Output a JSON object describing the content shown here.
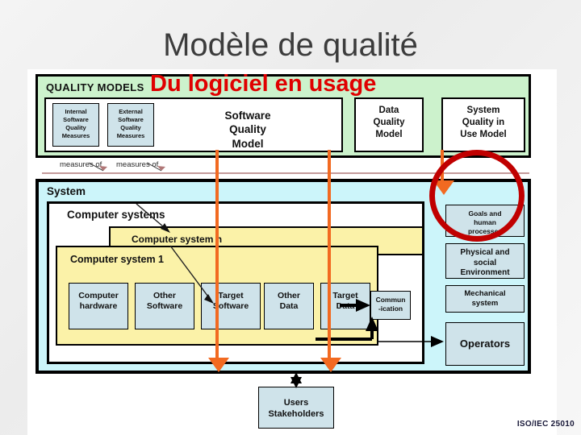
{
  "slide": {
    "title": "Modèle de qualité",
    "subtitle": "Du logiciel en usage",
    "footer": "ISO/IEC 25010"
  },
  "quality_models": {
    "panel_title": "QUALITY MODELS",
    "measure_boxes": [
      {
        "label": "Internal\nSoftware\nQuality\nMeasures"
      },
      {
        "label": "External\nSoftware\nQuality\nMeasures"
      }
    ],
    "software_quality_model": "Software\nQuality\nModel",
    "data_quality_model": "Data\nQuality\nModel",
    "system_quality_in_use_model": "System\nQuality in\nUse Model"
  },
  "measures_band": {
    "left_label": "measures of",
    "right_label": "measures of"
  },
  "system": {
    "panel_title": "System",
    "computer_systems_title": "Computer systems",
    "computer_system_n": "Computer system n",
    "computer_system_1": "Computer system 1",
    "leaves": [
      {
        "label": "Computer\nhardware"
      },
      {
        "label": "Other\nSoftware"
      },
      {
        "label": "Target\nSoftware"
      },
      {
        "label": "Other\nData"
      },
      {
        "label": "Target\nData"
      }
    ],
    "communication": "Commun\n-ication",
    "context_boxes": [
      {
        "label": "Goals and\nhuman\nprocesses"
      },
      {
        "label": "Physical and\nsocial\nEnvironment"
      },
      {
        "label": "Mechanical\nsystem"
      },
      {
        "label": "Operators"
      }
    ]
  },
  "users": {
    "label": "Users\nStakeholders"
  },
  "annotations": {
    "highlight_color": "#c00000",
    "arrow_color": "#f26a21",
    "circled_target": "System Quality in Use Model",
    "arrows": [
      {
        "from": "Software Quality Model",
        "to": "Target Software"
      },
      {
        "from": "Data Quality Model",
        "to": "Target Data"
      },
      {
        "from": "System Quality in Use Model",
        "to": "System"
      }
    ]
  }
}
